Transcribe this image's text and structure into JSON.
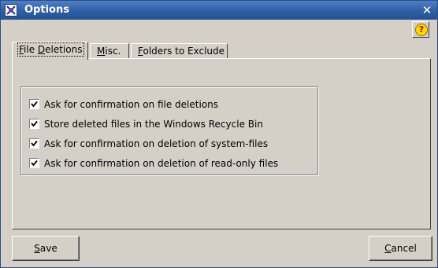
{
  "window": {
    "title": "Options",
    "close_label": "✕"
  },
  "help": {
    "label": "?"
  },
  "tabs": [
    {
      "u": "F",
      "rest": "ile ",
      "u2": "D",
      "rest2": "eletions",
      "selected": true
    },
    {
      "u": "M",
      "rest": "isc.",
      "u2": "",
      "rest2": "",
      "selected": false
    },
    {
      "u": "F",
      "rest": "olders to Exclude",
      "u2": "",
      "rest2": "",
      "selected": false
    }
  ],
  "options": [
    {
      "label": "Ask for confirmation on file deletions",
      "checked": true
    },
    {
      "label": "Store deleted files in the Windows Recycle Bin",
      "checked": true
    },
    {
      "label": "Ask for confirmation on deletion of system-files",
      "checked": true
    },
    {
      "label": "Ask for confirmation on deletion of read-only files",
      "checked": true
    }
  ],
  "buttons": {
    "save": {
      "u": "S",
      "rest": "ave"
    },
    "cancel": {
      "u": "C",
      "rest": "ancel"
    }
  },
  "colors": {
    "face": "#d4d0c8",
    "title_start": "#4f7fc4",
    "title_end": "#24518f"
  }
}
